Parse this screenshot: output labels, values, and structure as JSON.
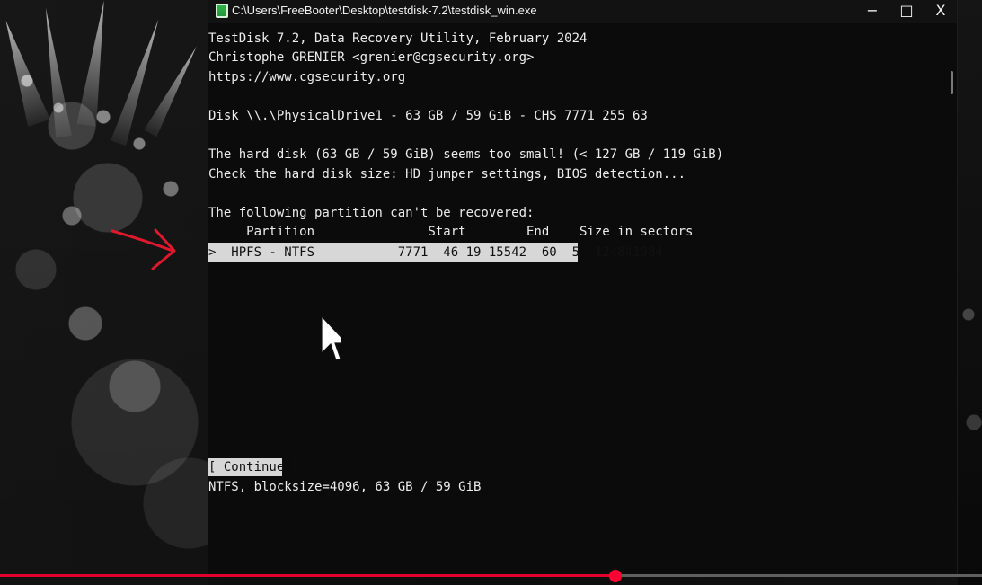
{
  "window": {
    "title": "C:\\Users\\FreeBooter\\Desktop\\testdisk-7.2\\testdisk_win.exe",
    "controls": {
      "minimize": "−",
      "maximize": "□",
      "close": "X"
    }
  },
  "terminal": {
    "lines": [
      "TestDisk 7.2, Data Recovery Utility, February 2024",
      "Christophe GRENIER <grenier@cgsecurity.org>",
      "https://www.cgsecurity.org",
      "",
      "Disk \\\\.\\PhysicalDrive1 - 63 GB / 59 GiB - CHS 7771 255 63",
      "",
      "The hard disk (63 GB / 59 GiB) seems too small! (< 127 GB / 119 GiB)",
      "Check the hard disk size: HD jumper settings, BIOS detection...",
      "",
      "The following partition can't be recovered:",
      "     Partition               Start        End    Size in sectors"
    ],
    "selected_partition": ">  HPFS - NTFS           7771  46 19 15542  60  5  124841984",
    "continue_button": "[ Continue ]",
    "footer_text": "NTFS, blocksize=4096, 63 GB / 59 GiB"
  },
  "player": {
    "progress": 0.627
  },
  "colors": {
    "terminal_bg": "#0b0b0b",
    "terminal_text": "#ececec",
    "selection_bg": "#d7d7d7",
    "selection_text": "#111111",
    "progress_red": "#ff0033",
    "annotation_red": "#e0182d"
  },
  "icons": {
    "title_icon": "testdisk-app-icon",
    "annotation_arrow": "red-arrow-icon",
    "mouse_cursor": "mouse-cursor-icon"
  }
}
